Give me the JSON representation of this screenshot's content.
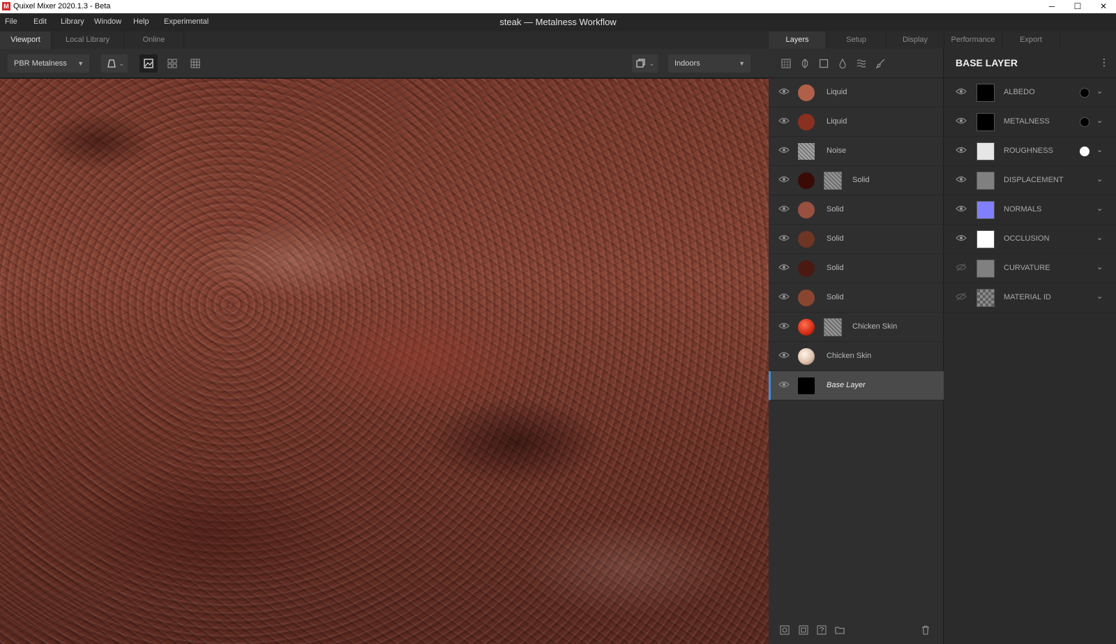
{
  "window": {
    "title": "Quixel Mixer 2020.1.3 - Beta",
    "controls": {
      "minimize": "─",
      "maximize": "☐",
      "close": "✕"
    }
  },
  "menu": {
    "items": [
      "File",
      "Edit",
      "Library",
      "Window",
      "Help",
      "Experimental"
    ],
    "document_title": "steak — Metalness Workflow"
  },
  "left_tabs": [
    "Viewport",
    "Local Library",
    "Online"
  ],
  "viewport_toolbar": {
    "shading_mode": "PBR Metalness",
    "environment": "Indoors"
  },
  "right_tabs": [
    "Layers",
    "Setup",
    "Display",
    "Performance",
    "Export"
  ],
  "layers": [
    {
      "name": "Liquid",
      "color": "#b06048",
      "mask": false,
      "selected": false
    },
    {
      "name": "Liquid",
      "color": "#8a3020",
      "mask": false,
      "selected": false
    },
    {
      "name": "Noise",
      "color": "texture",
      "mask": false,
      "selected": false
    },
    {
      "name": "Solid",
      "color": "#3a0a06",
      "mask": true,
      "selected": false
    },
    {
      "name": "Solid",
      "color": "#9a5040",
      "mask": false,
      "selected": false
    },
    {
      "name": "Solid",
      "color": "#6e3424",
      "mask": false,
      "selected": false
    },
    {
      "name": "Solid",
      "color": "#4a1a12",
      "mask": false,
      "selected": false
    },
    {
      "name": "Solid",
      "color": "#8a4530",
      "mask": false,
      "selected": false
    },
    {
      "name": "Chicken Skin",
      "color": "#d83018",
      "mask": true,
      "selected": false
    },
    {
      "name": "Chicken Skin",
      "color": "#e8d0c0",
      "mask": false,
      "selected": false
    },
    {
      "name": "Base Layer",
      "color": "#000000",
      "mask": false,
      "selected": true
    }
  ],
  "properties": {
    "title": "BASE LAYER",
    "channels": [
      {
        "name": "ALBEDO",
        "thumb": "#000000",
        "dot": "#000000",
        "visible": true
      },
      {
        "name": "METALNESS",
        "thumb": "#000000",
        "dot": "#000000",
        "visible": true
      },
      {
        "name": "ROUGHNESS",
        "thumb": "#e6e6e6",
        "dot": "#ffffff",
        "visible": true
      },
      {
        "name": "DISPLACEMENT",
        "thumb": "#808080",
        "dot": null,
        "visible": true
      },
      {
        "name": "NORMALS",
        "thumb": "#8080ff",
        "dot": null,
        "visible": true
      },
      {
        "name": "OCCLUSION",
        "thumb": "#ffffff",
        "dot": null,
        "visible": true
      },
      {
        "name": "CURVATURE",
        "thumb": "#808080",
        "dot": null,
        "visible": false
      },
      {
        "name": "MATERIAL ID",
        "thumb": "checker",
        "dot": null,
        "visible": false
      }
    ]
  }
}
